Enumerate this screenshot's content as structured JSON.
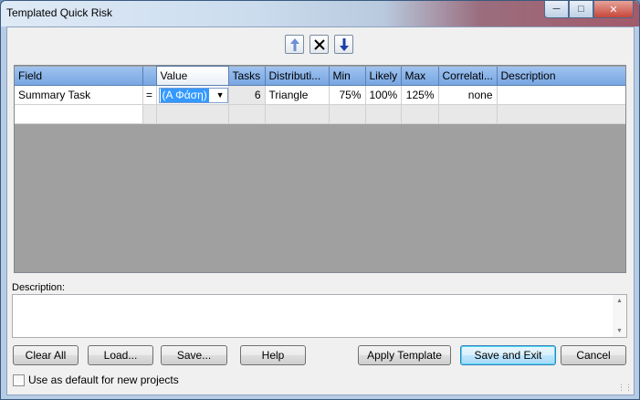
{
  "window": {
    "title": "Templated Quick Risk"
  },
  "grid": {
    "columns": [
      "Field",
      "",
      "Value",
      "Tasks",
      "Distributi...",
      "Min",
      "Likely",
      "Max",
      "Correlati...",
      "Description"
    ],
    "row": {
      "field": "Summary Task",
      "operator": "=",
      "value": "(Α Φάση)",
      "tasks": "6",
      "distribution": "Triangle",
      "min": "75%",
      "likely": "100%",
      "max": "125%",
      "correlation": "none",
      "description": ""
    }
  },
  "description": {
    "label": "Description:",
    "value": ""
  },
  "buttons": {
    "clear_all": "Clear All",
    "load": "Load...",
    "save": "Save...",
    "help": "Help",
    "apply_template": "Apply Template",
    "save_and_exit": "Save and Exit",
    "cancel": "Cancel"
  },
  "checkbox": {
    "label": "Use as default for new projects",
    "checked": false
  }
}
